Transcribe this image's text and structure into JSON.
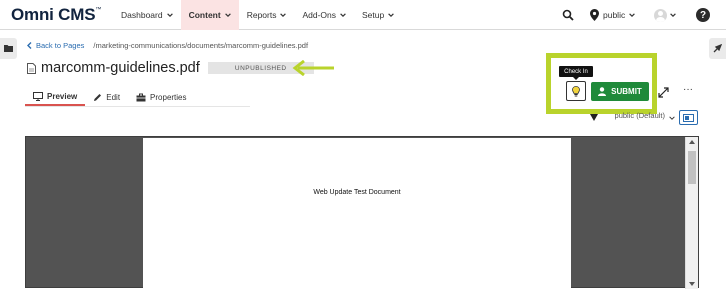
{
  "app": {
    "logo_text": "Omni CMS",
    "logo_mark": "™"
  },
  "nav": {
    "items": [
      {
        "label": "Dashboard"
      },
      {
        "label": "Content"
      },
      {
        "label": "Reports"
      },
      {
        "label": "Add-Ons"
      },
      {
        "label": "Setup"
      }
    ],
    "active": "Content",
    "publish_target": "public",
    "help_glyph": "?"
  },
  "breadcrumb": {
    "back_label": "Back to Pages",
    "path": "/marketing-communications/documents/marcomm-guidelines.pdf"
  },
  "page": {
    "title": "marcomm-guidelines.pdf",
    "status": "UNPUBLISHED"
  },
  "tabs": [
    {
      "label": "Preview",
      "icon": "monitor-icon"
    },
    {
      "label": "Edit",
      "icon": "pencil-icon"
    },
    {
      "label": "Properties",
      "icon": "briefcase-icon"
    }
  ],
  "actions": {
    "checkin_tooltip": "Check In",
    "submit_label": "SUBMIT",
    "more_label": "···"
  },
  "preview": {
    "target_select": "public (Default)",
    "doc_text": "Web Update Test Document"
  },
  "colors": {
    "brand": "#12243f",
    "accent": "#d9534f",
    "submit": "#1f8a3a",
    "highlight": "#b9d32c",
    "link": "#2a6cb0"
  }
}
